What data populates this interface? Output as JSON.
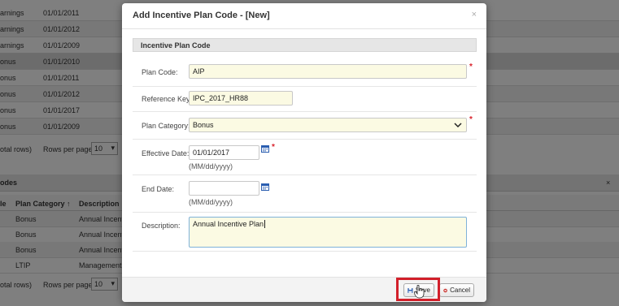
{
  "background": {
    "top_rows": [
      {
        "c1": "arnings",
        "c2": "01/01/2011"
      },
      {
        "c1": "arnings",
        "c2": "01/01/2012"
      },
      {
        "c1": "arnings",
        "c2": "01/01/2009"
      },
      {
        "c1": "onus",
        "c2": "01/01/2010"
      },
      {
        "c1": "onus",
        "c2": "01/01/2011"
      },
      {
        "c1": "onus",
        "c2": "01/01/2012"
      },
      {
        "c1": "onus",
        "c2": "01/01/2017"
      },
      {
        "c1": "onus",
        "c2": "01/01/2009"
      }
    ],
    "pager1": {
      "total": "otal rows)",
      "rows_per_page": "Rows per page:",
      "page_size": "10"
    },
    "section_title": "odes",
    "section_close": "×",
    "columns": [
      "le",
      "Plan Category ↑",
      "Description"
    ],
    "bottom_rows": [
      {
        "c1": "",
        "c2": "Bonus",
        "c3": "Annual Incenti"
      },
      {
        "c1": "",
        "c2": "Bonus",
        "c3": "Annual Incenti"
      },
      {
        "c1": "",
        "c2": "Bonus",
        "c3": "Annual Incenti"
      },
      {
        "c1": "",
        "c2": "LTIP",
        "c3": "Management I"
      }
    ],
    "pager2": {
      "total": "otal rows)",
      "rows_per_page": "Rows per page:",
      "page_size": "10"
    }
  },
  "modal": {
    "title": "Add Incentive Plan Code - [New]",
    "close": "×",
    "panel_title": "Incentive Plan Code",
    "fields": {
      "plan_code": {
        "label": "Plan Code:",
        "value": "AIP",
        "required": "*"
      },
      "reference_key": {
        "label": "Reference Key:",
        "value": "IPC_2017_HR88"
      },
      "plan_category": {
        "label": "Plan Category:",
        "value": "Bonus",
        "required": "*"
      },
      "effective_date": {
        "label": "Effective Date:",
        "value": "01/01/2017",
        "hint": "(MM/dd/yyyy)",
        "required": "*"
      },
      "end_date": {
        "label": "End Date:",
        "value": "",
        "hint": "(MM/dd/yyyy)"
      },
      "description": {
        "label": "Description:",
        "value": "Annual Incentive Plan"
      }
    },
    "buttons": {
      "save": "Save",
      "cancel": "Cancel"
    }
  },
  "colors": {
    "input_bg": "#fbfae3",
    "required": "#d9232d",
    "highlight": "#d21f2a",
    "calendar": "#2a5db0"
  }
}
